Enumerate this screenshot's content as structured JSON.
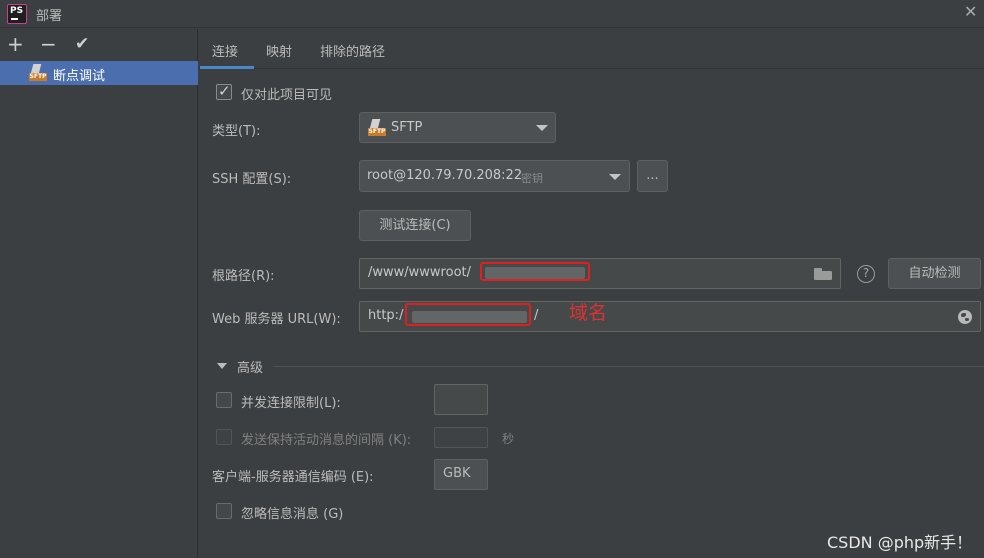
{
  "window": {
    "title": "部署",
    "app_logo_text": "PS"
  },
  "sidebar": {
    "toolbar": {
      "add": "+",
      "remove": "−",
      "apply": "✔"
    },
    "items": [
      {
        "label": "断点调试",
        "icon": "sftp-icon",
        "selected": true
      }
    ]
  },
  "tabs": [
    {
      "label": "连接",
      "active": true
    },
    {
      "label": "映射",
      "active": false
    },
    {
      "label": "排除的路径",
      "active": false
    }
  ],
  "connection": {
    "visible_only_project": {
      "label": "仅对此项目可见",
      "checked": true
    },
    "type": {
      "label": "类型(T):",
      "value": "SFTP"
    },
    "ssh_config": {
      "label": "SSH 配置(S):",
      "value": "root@120.79.70.208:22",
      "suffix": "密钥",
      "more_button": "..."
    },
    "test_button": "测试连接(C)",
    "root_path": {
      "label": "根路径(R):",
      "value": "/www/wwwroot/",
      "detect_button": "自动检测",
      "help": "?"
    },
    "web_url": {
      "label": "Web 服务器 URL(W):",
      "value_prefix": "http:/",
      "value_suffix": "/"
    },
    "annotation": "域名"
  },
  "advanced": {
    "title": "高级",
    "concurrent_limit": {
      "label": "并发连接限制(L):",
      "checked": false,
      "value": ""
    },
    "keepalive": {
      "label": "发送保持活动消息的间隔 (K):",
      "checked": false,
      "value": "",
      "unit": "秒",
      "disabled": true
    },
    "encoding": {
      "label": "客户端-服务器通信编码 (E):",
      "value": "GBK"
    },
    "ignore_info": {
      "label": "忽略信息消息 (G)",
      "checked": false
    }
  },
  "watermark": "CSDN @php新手！",
  "colors": {
    "background": "#3c3f41",
    "selection": "#4b6eaf",
    "accent": "#4a88c7",
    "annotation_red": "#e02020"
  }
}
